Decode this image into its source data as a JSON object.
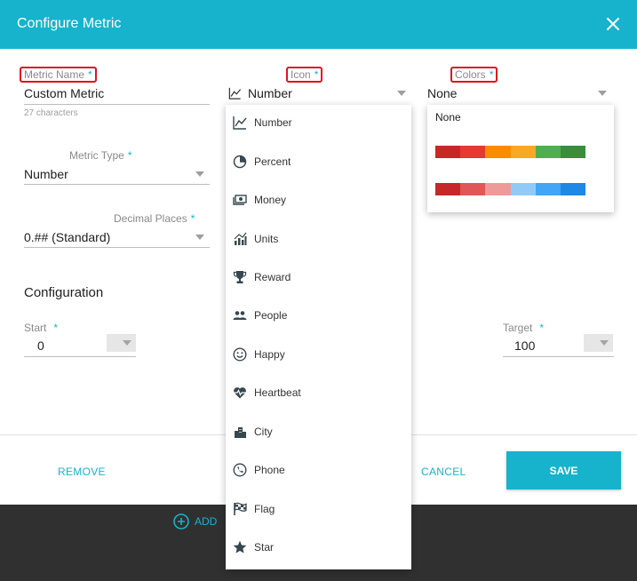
{
  "dialog": {
    "title": "Configure Metric",
    "accent_color": "#17b3cc"
  },
  "metric_name": {
    "label": "Metric Name",
    "required": "*",
    "value": "Custom Metric",
    "helper": "27 characters"
  },
  "icon_field": {
    "label": "Icon",
    "required": "*",
    "value": "Number"
  },
  "colors_field": {
    "label": "Colors",
    "required": "*",
    "value": "None"
  },
  "metric_type": {
    "label": "Metric Type",
    "required": "*",
    "value": "Number"
  },
  "decimal_places": {
    "label": "Decimal Places",
    "required": "*",
    "value": "0.## (Standard)"
  },
  "configuration": {
    "title": "Configuration",
    "start_label": "Start",
    "start_required": "*",
    "start_value": "0",
    "target_label": "Target",
    "target_required": "*",
    "target_value": "100"
  },
  "footer": {
    "remove_label": "REMOVE",
    "cancel_label": "CANCEL",
    "save_label": "SAVE",
    "add_label": "ADD"
  },
  "icon_menu": {
    "items": [
      {
        "label": "Number",
        "icon": "line-chart-icon"
      },
      {
        "label": "Percent",
        "icon": "pie-chart-icon"
      },
      {
        "label": "Money",
        "icon": "money-icon"
      },
      {
        "label": "Units",
        "icon": "units-chart-icon"
      },
      {
        "label": "Reward",
        "icon": "trophy-icon"
      },
      {
        "label": "People",
        "icon": "people-icon"
      },
      {
        "label": "Happy",
        "icon": "smiley-icon"
      },
      {
        "label": "Heartbeat",
        "icon": "heartbeat-icon"
      },
      {
        "label": "City",
        "icon": "city-icon"
      },
      {
        "label": "Phone",
        "icon": "phone-icon"
      },
      {
        "label": "Flag",
        "icon": "flag-icon"
      },
      {
        "label": "Star",
        "icon": "star-icon"
      }
    ]
  },
  "color_menu": {
    "none_label": "None",
    "palettes": [
      [
        "#c62828",
        "#e53935",
        "#fb8c00",
        "#f9a825",
        "#4caf50",
        "#388e3c"
      ],
      [
        "#c62828",
        "#e05757",
        "#ef9a9a",
        "#90caf9",
        "#42a5f5",
        "#1e88e5"
      ]
    ]
  }
}
